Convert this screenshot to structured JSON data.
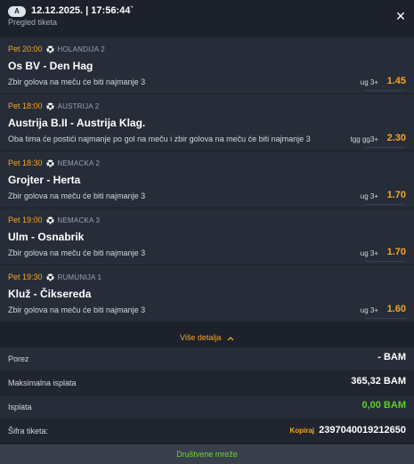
{
  "header": {
    "badge": "A",
    "ticket_date": "12.12.2025. | 17:56:44`",
    "subtitle": "Pregled tiketa",
    "close_glyph": "✕"
  },
  "events": [
    {
      "time": "Pet 20:00",
      "league": "HOLANDIJA 2",
      "match": "Os BV - Den Hag",
      "market": "Zbir golova na meču će biti najmanje 3",
      "pick": "ug 3+",
      "odd": "1.45"
    },
    {
      "time": "Pet 18:00",
      "league": "AUSTRIJA 2",
      "match": "Austrija B.II - Austrija Klag.",
      "market": "Oba tima će postići najmanje po gol na meču i zbir golova na meču će biti najmanje 3",
      "pick": "tgg gg3+",
      "odd": "2.30"
    },
    {
      "time": "Pet 18:30",
      "league": "NEMACKA 2",
      "match": "Grojter - Herta",
      "market": "Zbir golova na meču će biti najmanje 3",
      "pick": "ug 3+",
      "odd": "1.70"
    },
    {
      "time": "Pet 19:00",
      "league": "NEMACKA 3",
      "match": "Ulm - Osnabrik",
      "market": "Zbir golova na meču će biti najmanje 3",
      "pick": "ug 3+",
      "odd": "1.70"
    },
    {
      "time": "Pet 19:30",
      "league": "RUMUNIJA 1",
      "match": "Kluž - Čiksereda",
      "market": "Zbir golova na meču će biti najmanje 3",
      "pick": "ug 3+",
      "odd": "1.60"
    }
  ],
  "more_details": "Više detalja",
  "summary": {
    "tax_label": "Porez",
    "tax_value": "- BAM",
    "max_payout_label": "Maksimalna isplata",
    "max_payout_value": "365,32 BAM",
    "payout_label": "Isplata",
    "payout_value": "0,00 BAM",
    "ticket_code_label": "Šifra tiketa:",
    "copy_label": "Kopiraj",
    "ticket_code": "2397040019212650"
  },
  "social_button": "Društvene mreže",
  "colors": {
    "background": "#1c212b",
    "card": "#262c38",
    "accent": "#f5a623",
    "green": "#5ed12b"
  },
  "icons": {
    "close": "close-icon",
    "sport": "soccer-ball-icon",
    "chevron": "chevron-up-icon"
  }
}
